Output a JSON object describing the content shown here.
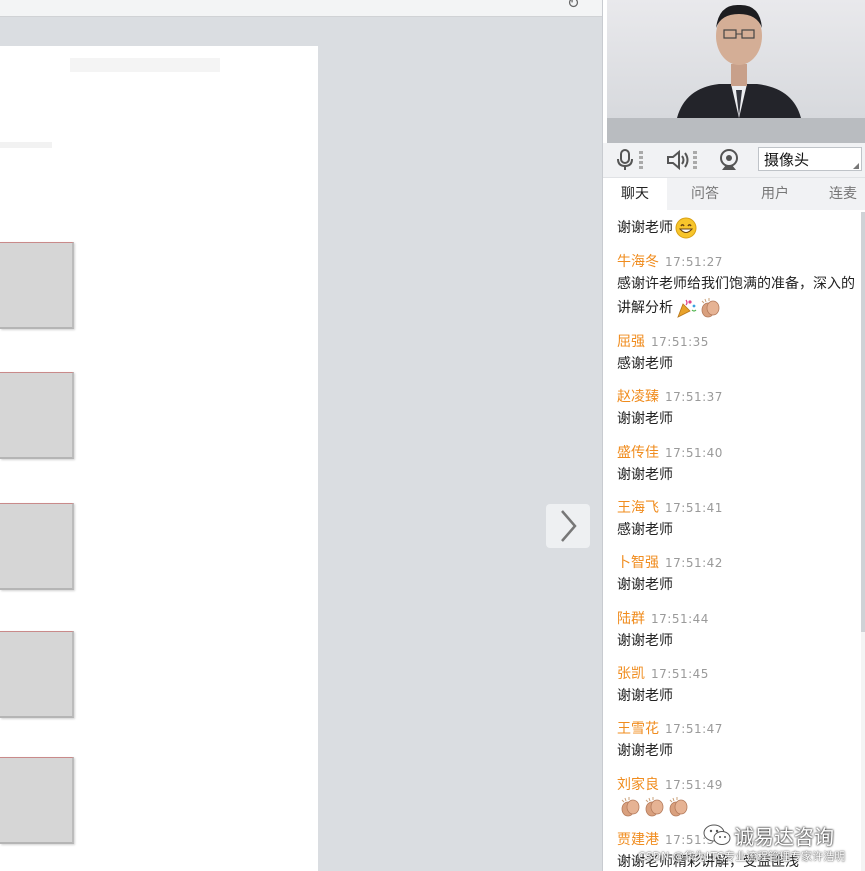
{
  "media": {
    "camera_label": "摄像头"
  },
  "tabs": [
    "聊天",
    "问答",
    "用户",
    "连麦"
  ],
  "messages": [
    {
      "name": "",
      "time": "",
      "text": "谢谢老师",
      "emoji": [
        "grin"
      ]
    },
    {
      "name": "牛海冬",
      "time": "17:51:27",
      "text": "感谢许老师给我们饱满的准备，深入的讲解分析",
      "emoji": [
        "party",
        "clap"
      ]
    },
    {
      "name": "屈强",
      "time": "17:51:35",
      "text": "感谢老师",
      "emoji": []
    },
    {
      "name": "赵凌臻",
      "time": "17:51:37",
      "text": "谢谢老师",
      "emoji": []
    },
    {
      "name": "盛传佳",
      "time": "17:51:40",
      "text": "谢谢老师",
      "emoji": []
    },
    {
      "name": "王海飞",
      "time": "17:51:41",
      "text": "感谢老师",
      "emoji": []
    },
    {
      "name": "卜智强",
      "time": "17:51:42",
      "text": "谢谢老师",
      "emoji": []
    },
    {
      "name": "陆群",
      "time": "17:51:44",
      "text": "谢谢老师",
      "emoji": []
    },
    {
      "name": "张凯",
      "time": "17:51:45",
      "text": "谢谢老师",
      "emoji": []
    },
    {
      "name": "王雪花",
      "time": "17:51:47",
      "text": "谢谢老师",
      "emoji": []
    },
    {
      "name": "刘家良",
      "time": "17:51:49",
      "text": "",
      "emoji": [
        "clap",
        "clap",
        "clap"
      ]
    },
    {
      "name": "贾建港",
      "time": "17:51:5",
      "text": "谢谢老师精彩讲解，受益匪浅",
      "emoji": []
    }
  ],
  "watermark": {
    "main": "诚易达咨询",
    "sub": "CSDN @华为LTC专业流程管理专家许浩明"
  }
}
